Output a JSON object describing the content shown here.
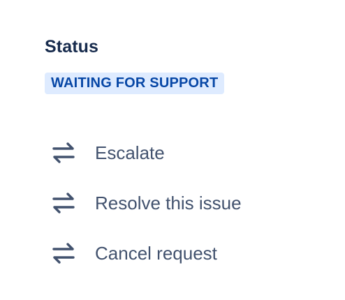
{
  "status": {
    "heading": "Status",
    "value": "WAITING FOR SUPPORT",
    "lozenge_bg": "#deebff",
    "lozenge_fg": "#0747a6"
  },
  "transitions": [
    {
      "label": "Escalate",
      "icon": "transition-arrows-icon"
    },
    {
      "label": "Resolve this issue",
      "icon": "transition-arrows-icon"
    },
    {
      "label": "Cancel request",
      "icon": "transition-arrows-icon"
    }
  ]
}
